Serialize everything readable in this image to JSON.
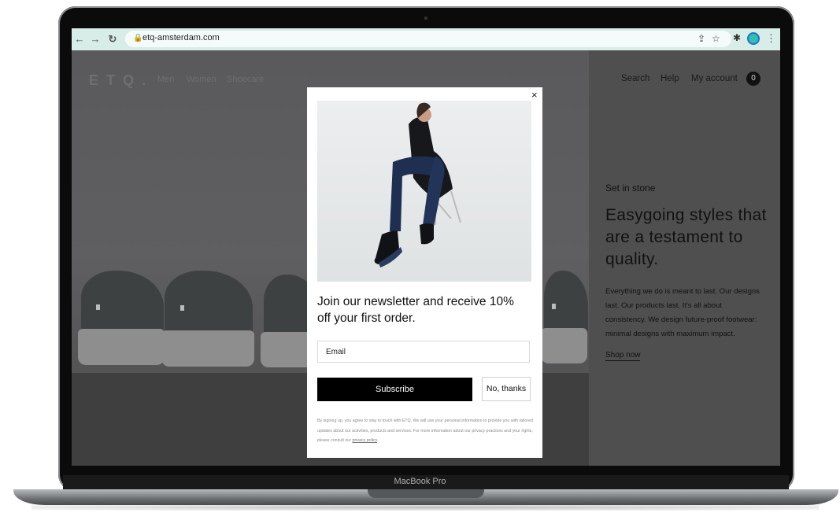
{
  "browser": {
    "url": "etq-amsterdam.com"
  },
  "site": {
    "brand": "ETQ.",
    "nav": [
      "Men",
      "Women",
      "Shoecare"
    ],
    "utility_nav": [
      "Search",
      "Help",
      "My account"
    ],
    "cart_count": "0"
  },
  "hero_side": {
    "eyebrow": "Set in stone",
    "headline": "Easygoing styles that are a testament to quality.",
    "body": "Everything we do is meant to last. Our designs last. Our products last. It's all about consistency. We design future-proof footwear: minimal designs with maximum impact.",
    "cta": "Shop now"
  },
  "modal": {
    "close": "×",
    "title": "Join our newsletter and receive 10% off your first order.",
    "email_placeholder": "Email",
    "subscribe": "Subscribe",
    "decline": "No, thanks",
    "legal": "By signing up, you agree to stay in touch with ETQ. We will use your personal information to provide you with tailored updates about our activities, products and services. For more information about our privacy practices and your rights, please consult our",
    "legal_link": "privacy policy",
    "legal_end": "."
  },
  "device": {
    "label": "MacBook Pro"
  },
  "colors": {
    "chrome_bar": "#d8ece8",
    "profile_ring": "#1e6fd9",
    "profile_fill": "#30c2a8"
  }
}
